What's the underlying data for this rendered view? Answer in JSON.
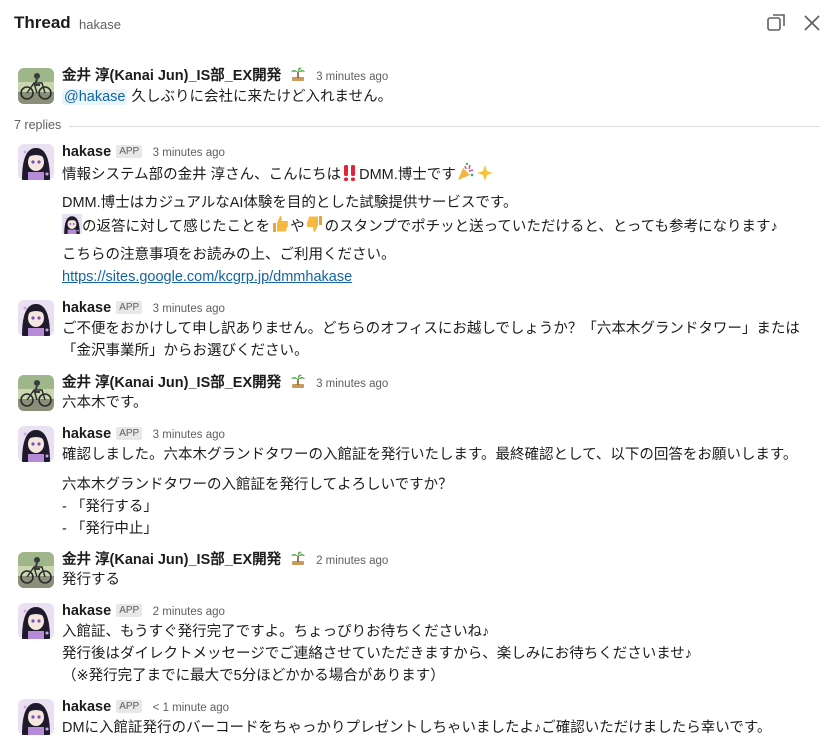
{
  "header": {
    "title": "Thread",
    "channel": "hakase"
  },
  "replies_label": "7 replies",
  "users": {
    "kanai": "金井 淳(Kanai Jun)_IS部_EX開発",
    "hakase": "hakase",
    "app_badge": "APP"
  },
  "messages": [
    {
      "time": "3 minutes ago",
      "mention": "@hakase",
      "text": "久しぶりに会社に来たけど入れません。"
    },
    {
      "time": "3 minutes ago",
      "line1a": "情報システム部の金井 淳さん、こんにちは",
      "line1b": "DMM.博士です",
      "line2": "DMM.博士はカジュアルなAI体験を目的とした試験提供サービスです。",
      "line3a": "の返答に対して感じたことを",
      "line3b": "や",
      "line3c": "のスタンプでポチッと送っていただけると、とっても参考になります♪",
      "line4": "こちらの注意事項をお読みの上、ご利用ください。",
      "link": "https://sites.google.com/kcgrp.jp/dmmhakase"
    },
    {
      "time": "3 minutes ago",
      "line1": "ご不便をおかけして申し訳ありません。どちらのオフィスにお越しでしょうか？「六本木グランドタワー」または",
      "line2": "「金沢事業所」からお選びください。"
    },
    {
      "time": "3 minutes ago",
      "text": "六本木です。"
    },
    {
      "time": "3 minutes ago",
      "line1": "確認しました。六本木グランドタワーの入館証を発行いたします。最終確認として、以下の回答をお願いします。",
      "line2": "六本木グランドタワーの入館証を発行してよろしいですか？",
      "line3": "- 「発行する」",
      "line4": "- 「発行中止」"
    },
    {
      "time": "2 minutes ago",
      "text": "発行する"
    },
    {
      "time": "2 minutes ago",
      "line1": "入館証、もうすぐ発行完了ですよ。ちょっぴりお待ちくださいね♪",
      "line2": "発行後はダイレクトメッセージでご連絡させていただきますから、楽しみにお待ちくださいませ♪",
      "line3": "（※発行完了までに最大で5分ほどかかる場合があります）"
    },
    {
      "time": "< 1 minute ago",
      "text": "DMに入館証発行のバーコードをちゃっかりプレゼントしちゃいましたよ♪ご確認いただけましたら幸いです。"
    }
  ],
  "colors": {
    "text": "#1d1c1d",
    "muted": "#616061",
    "link": "#1264a3",
    "mention_bg": "#e8f5fa"
  },
  "icons": [
    "popout-icon",
    "close-icon",
    "palm-tree-icon",
    "double-exclamation-emoji",
    "party-popper-emoji",
    "sparkles-emoji",
    "thumbs-up-emoji",
    "thumbs-down-emoji"
  ]
}
